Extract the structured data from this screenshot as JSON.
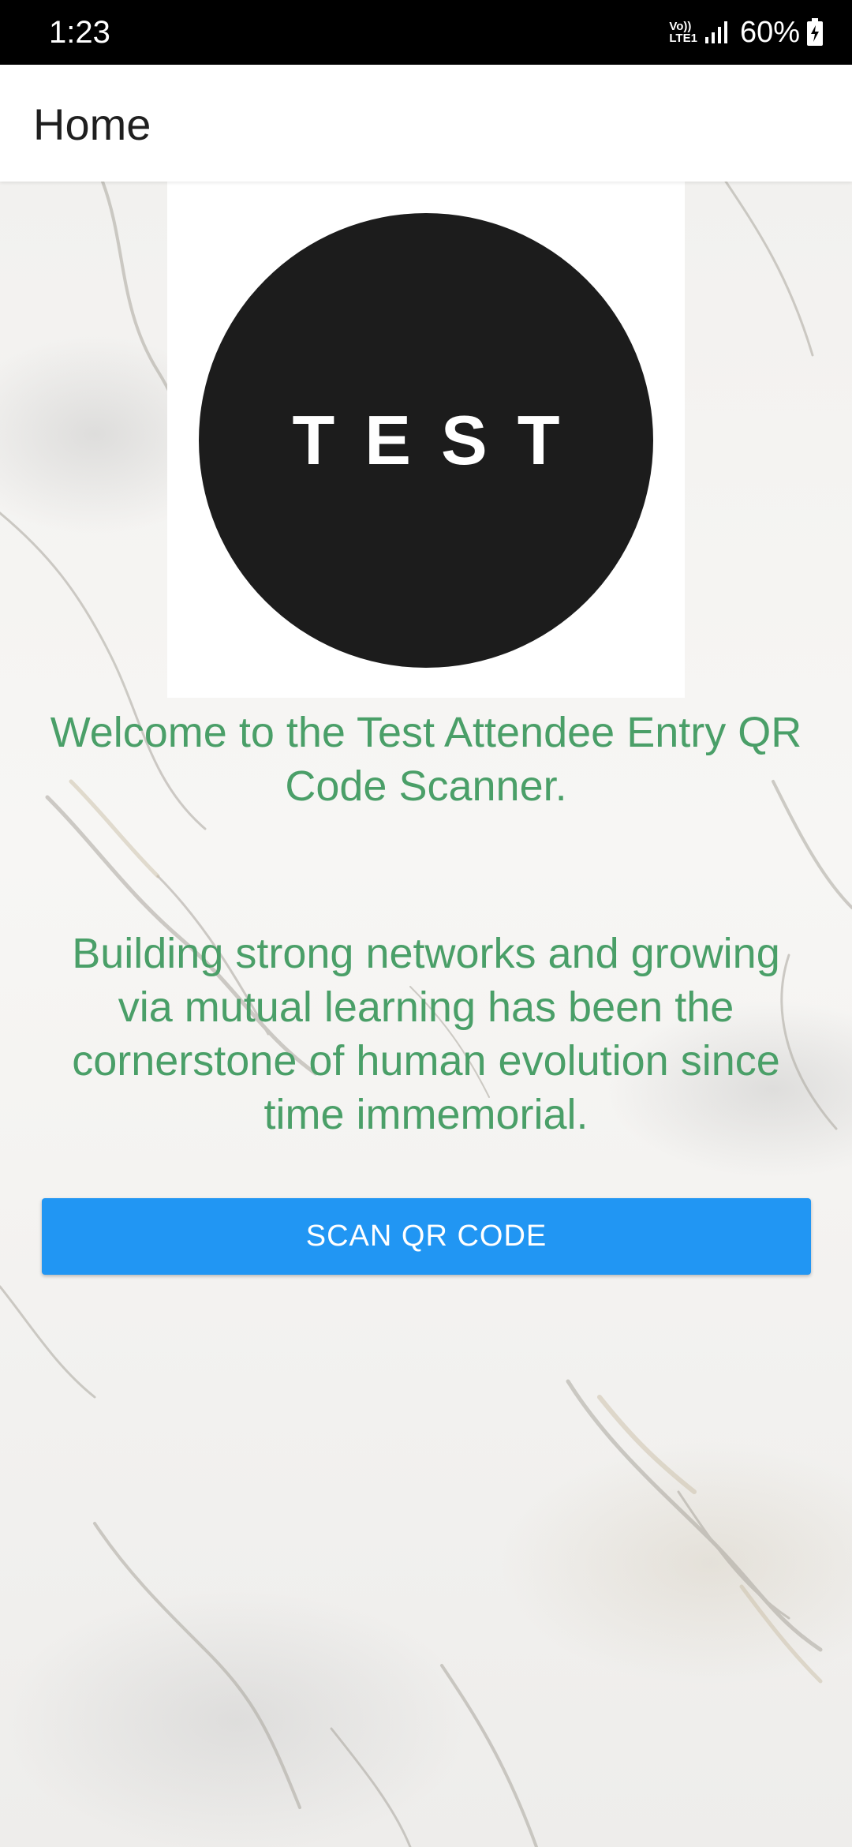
{
  "status_bar": {
    "time": "1:23",
    "volte_top": "Vo))",
    "volte_bottom": "LTE1",
    "battery_percent": "60%",
    "icons": [
      "volte-icon",
      "signal-icon",
      "battery-charging-icon"
    ]
  },
  "app_bar": {
    "title": "Home"
  },
  "logo": {
    "text": "TEST"
  },
  "main": {
    "welcome": "Welcome to the Test Attendee Entry QR Code Scanner.",
    "tagline": "Building strong networks and growing via mutual learning has been the cornerstone of human evolution since time immemorial.",
    "scan_button_label": "SCAN QR CODE"
  },
  "colors": {
    "accent_text": "#4a9f68",
    "button": "#2196f3",
    "app_bar": "#ffffff",
    "status_bar": "#000000"
  }
}
